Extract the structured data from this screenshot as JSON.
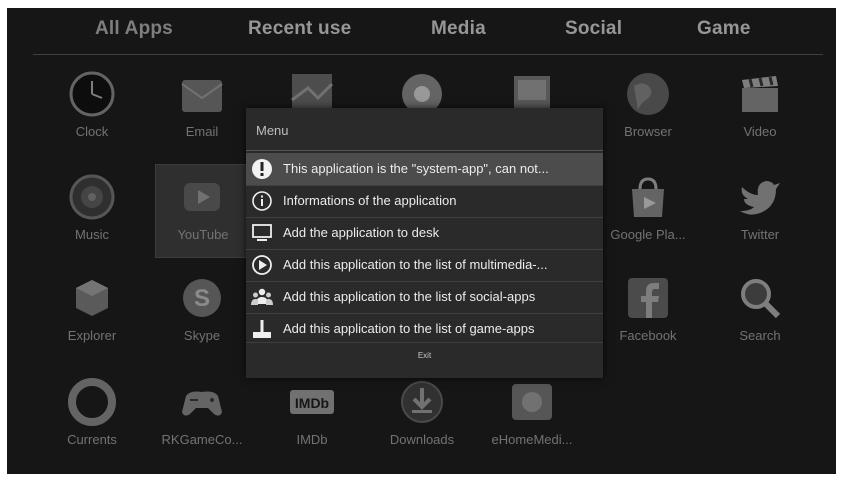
{
  "tabs": [
    "All Apps",
    "Recent use",
    "Media",
    "Social",
    "Game"
  ],
  "apps": [
    {
      "label": "Clock",
      "icon": "clock-icon"
    },
    {
      "label": "Email",
      "icon": "email-icon"
    },
    {
      "label": "",
      "icon": "maps-icon"
    },
    {
      "label": "",
      "icon": "app-icon"
    },
    {
      "label": "",
      "icon": "gallery-icon"
    },
    {
      "label": "Browser",
      "icon": "globe-icon"
    },
    {
      "label": "Video",
      "icon": "clapperboard-icon"
    },
    {
      "label": "Music",
      "icon": "speaker-icon"
    },
    {
      "label": "YouTube",
      "icon": "youtube-icon"
    },
    {
      "label": "Google Pla...",
      "icon": "play-store-icon"
    },
    {
      "label": "Twitter",
      "icon": "twitter-bird-icon"
    },
    {
      "label": "Explorer",
      "icon": "explorer-boxes-icon"
    },
    {
      "label": "Skype",
      "icon": "skype-icon"
    },
    {
      "label": "Facebook",
      "icon": "facebook-icon"
    },
    {
      "label": "Search",
      "icon": "magnifier-icon"
    },
    {
      "label": "Currents",
      "icon": "currents-icon"
    },
    {
      "label": "RKGameCo...",
      "icon": "gamepad-icon"
    },
    {
      "label": "IMDb",
      "icon": "imdb-icon"
    },
    {
      "label": "Downloads",
      "icon": "download-icon"
    },
    {
      "label": "eHomeMedi...",
      "icon": "ehome-icon"
    }
  ],
  "imdb_logo_text": "IMDb",
  "menu": {
    "title": "Menu",
    "items": [
      {
        "text": "This application is the \"system-app\", can not...",
        "icon": "exclamation-icon"
      },
      {
        "text": "Informations of the application",
        "icon": "info-icon"
      },
      {
        "text": "Add the application to desk",
        "icon": "monitor-icon"
      },
      {
        "text": "Add this application to the list of multimedia-...",
        "icon": "play-circle-icon"
      },
      {
        "text": "Add this application to the list of social-apps",
        "icon": "people-icon"
      },
      {
        "text": "Add this application to the list of game-apps",
        "icon": "joystick-icon"
      }
    ],
    "exit": "Exit"
  },
  "colors": {
    "background": "#1c1c1c",
    "menu_bg": "#2a2a2a",
    "highlight": "#4c4c4c"
  }
}
